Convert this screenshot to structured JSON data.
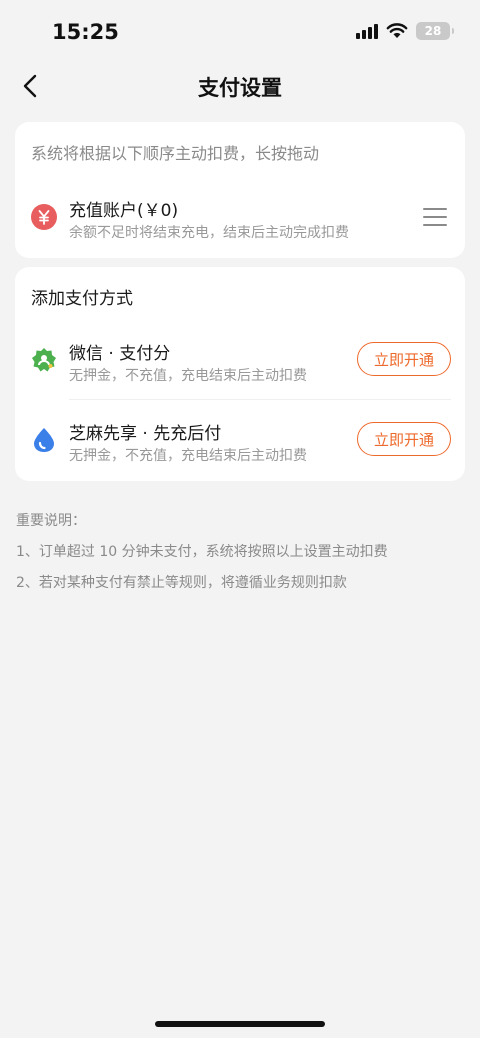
{
  "status_bar": {
    "time": "15:25",
    "battery": "28",
    "icons": [
      "signal-icon",
      "wifi-icon",
      "battery-icon"
    ]
  },
  "nav": {
    "title": "支付设置",
    "back_icon": "chevron-left-icon"
  },
  "order_card": {
    "hint": "系统将根据以下顺序主动扣费，长按拖动",
    "account": {
      "title": "充值账户(￥0)",
      "subtitle": "余额不足时将结束充电，结束后主动完成扣费",
      "icon": "yuan-icon",
      "icon_color": "#e85d5d"
    }
  },
  "add_card": {
    "title": "添加支付方式",
    "methods": [
      {
        "title": "微信 · 支付分",
        "subtitle": "无押金，不充值，充电结束后主动扣费",
        "button": "立即开通",
        "icon": "wechat-pay-score-icon",
        "icon_color": "#4cb04f"
      },
      {
        "title": "芝麻先享 · 先充后付",
        "subtitle": "无押金，不充值，充电结束后主动扣费",
        "button": "立即开通",
        "icon": "sesame-credit-icon",
        "icon_color": "#3b7fe8"
      }
    ]
  },
  "notes": {
    "heading": "重要说明：",
    "items": [
      "1、订单超过 10 分钟未支付，系统将按照以上设置主动扣费",
      "2、若对某种支付有禁止等规则，将遵循业务规则扣款"
    ]
  },
  "colors": {
    "accent": "#ee6a2c",
    "background": "#f3f3f3"
  }
}
